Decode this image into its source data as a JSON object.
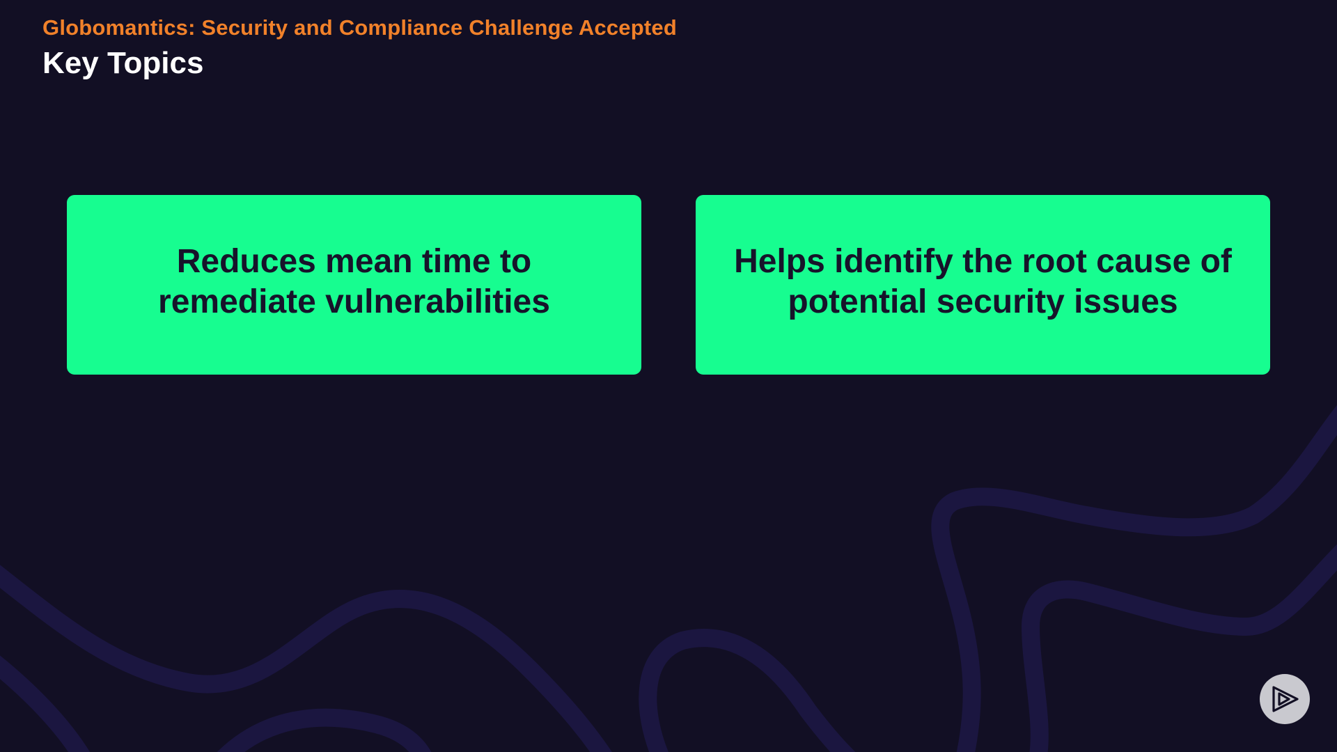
{
  "slide": {
    "subtitle": "Globomantics: Security and Compliance Challenge Accepted",
    "title": "Key Topics"
  },
  "cards": [
    {
      "text": "Reduces mean time to remediate vulnerabilities"
    },
    {
      "text": "Helps identify the root cause of potential security issues"
    }
  ],
  "controls": {
    "play_icon": "play-logo-icon"
  },
  "colors": {
    "background": "#120f24",
    "accent_orange": "#f1812a",
    "card_green": "#17fd90",
    "card_text": "#17132a",
    "wave": "#1c1640"
  }
}
